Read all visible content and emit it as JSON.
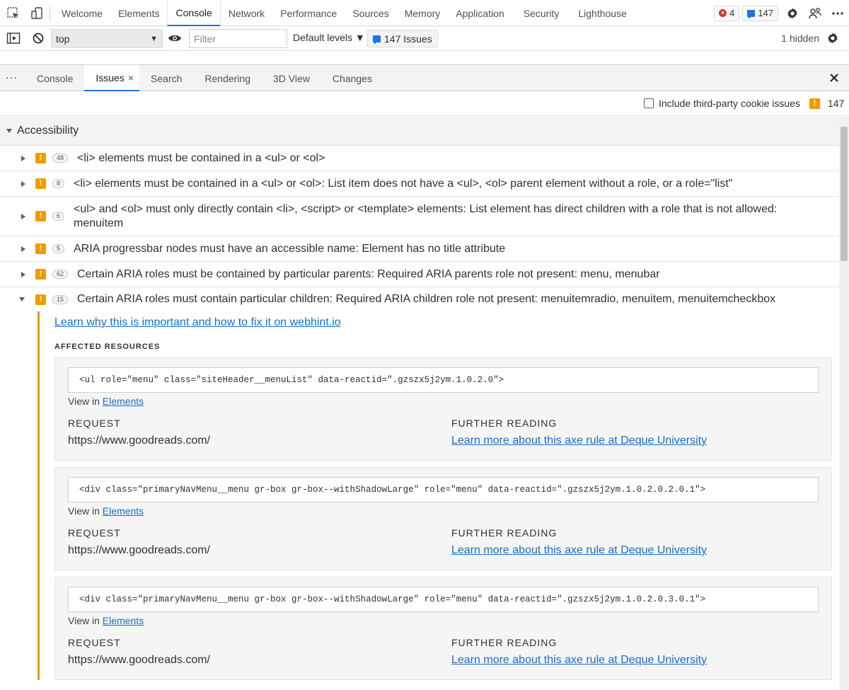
{
  "topbar": {
    "tabs": [
      "Welcome",
      "Elements",
      "Console",
      "Network",
      "Performance",
      "Sources",
      "Memory",
      "Application",
      "Security",
      "Lighthouse"
    ],
    "active_tab": "Console",
    "error_count": "4",
    "message_count": "147"
  },
  "console_toolbar": {
    "context": "top",
    "filter_placeholder": "Filter",
    "levels_label": "Default levels ▼",
    "issues_button": "147 Issues",
    "hidden_label": "1 hidden"
  },
  "drawer": {
    "more": "···",
    "tabs": [
      "Console",
      "Issues",
      "Search",
      "Rendering",
      "3D View",
      "Changes"
    ],
    "active_tab": "Issues",
    "close_glyph": "×"
  },
  "issues_toolbar": {
    "checkbox_label": "Include third-party cookie issues",
    "total_count": "147"
  },
  "category": "Accessibility",
  "issues": [
    {
      "count": "48",
      "title": "<li> elements must be contained in a <ul> or <ol>"
    },
    {
      "count": "8",
      "title": "<li> elements must be contained in a <ul> or <ol>: List item does not have a <ul>, <ol> parent element without a role, or a role=\"list\""
    },
    {
      "count": "6",
      "title": "<ul> and <ol> must only directly contain <li>, <script> or <template> elements: List element has direct children with a role that is not allowed: menuitem"
    },
    {
      "count": "5",
      "title": "ARIA progressbar nodes must have an accessible name: Element has no title attribute"
    },
    {
      "count": "62",
      "title": "Certain ARIA roles must be contained by particular parents: Required ARIA parents role not present: menu, menubar"
    },
    {
      "count": "15",
      "title": "Certain ARIA roles must contain particular children: Required ARIA children role not present: menuitemradio, menuitem, menuitemcheckbox"
    }
  ],
  "expanded_issue": {
    "learn_link": "Learn why this is important and how to fix it on webhint.io",
    "affected_label": "AFFECTED RESOURCES",
    "view_in_text": "View in",
    "view_in_link": "Elements",
    "request_label": "REQUEST",
    "further_label": "FURTHER READING",
    "resources": [
      {
        "code": "<ul role=\"menu\" class=\"siteHeader__menuList\" data-reactid=\".gzszx5j2ym.1.0.2.0\">",
        "request": "https://www.goodreads.com/",
        "further": "Learn more about this axe rule at Deque University"
      },
      {
        "code": "<div class=\"primaryNavMenu__menu gr-box gr-box--withShadowLarge\" role=\"menu\" data-reactid=\".gzszx5j2ym.1.0.2.0.2.0.1\">",
        "request": "https://www.goodreads.com/",
        "further": "Learn more about this axe rule at Deque University"
      },
      {
        "code": "<div class=\"primaryNavMenu__menu gr-box gr-box--withShadowLarge\" role=\"menu\" data-reactid=\".gzszx5j2ym.1.0.2.0.3.0.1\">",
        "request": "https://www.goodreads.com/",
        "further": "Learn more about this axe rule at Deque University"
      }
    ]
  },
  "colors": {
    "accent": "#1a73e8",
    "warning": "#f29900",
    "error": "#d93025",
    "link": "#1a6dc8"
  }
}
